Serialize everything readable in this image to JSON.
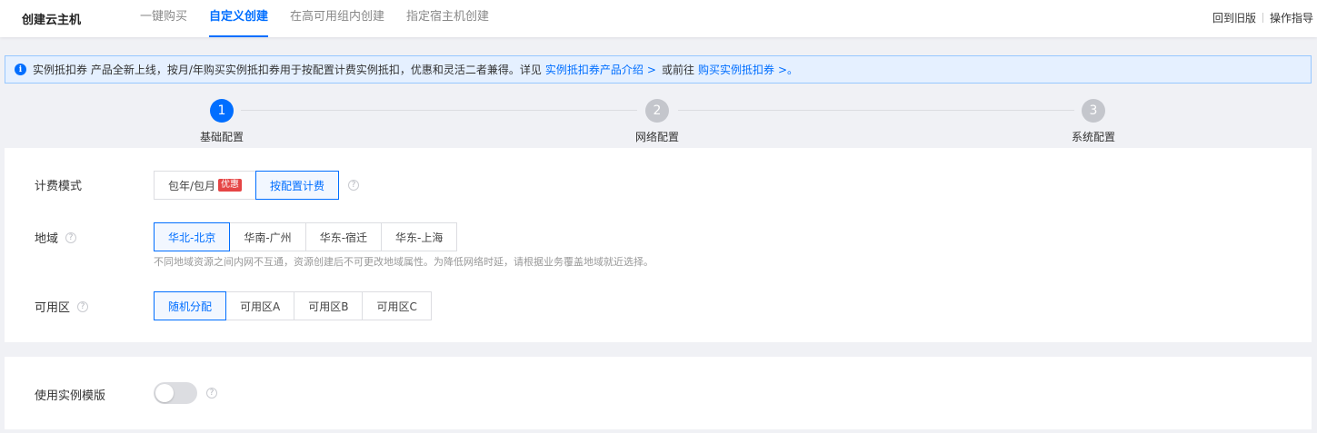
{
  "header": {
    "title": "创建云主机",
    "tabs": [
      {
        "label": "一键购买",
        "active": false
      },
      {
        "label": "自定义创建",
        "active": true
      },
      {
        "label": "在高可用组内创建",
        "active": false
      },
      {
        "label": "指定宿主机创建",
        "active": false
      }
    ],
    "links": {
      "back_old": "回到旧版",
      "guide": "操作指导"
    }
  },
  "notice": {
    "icon": "info-icon",
    "text1": "实例抵扣券 产品全新上线，按月/年购买实例抵扣券用于按配置计费实例抵扣，优惠和灵活二者兼得。详见",
    "link1": "实例抵扣券产品介绍",
    "arrow1": ">",
    "text2": "或前往",
    "link2": "购买实例抵扣券",
    "arrow2": ">。"
  },
  "steps": [
    {
      "number": "1",
      "label": "基础配置",
      "active": true
    },
    {
      "number": "2",
      "label": "网络配置",
      "active": false
    },
    {
      "number": "3",
      "label": "系统配置",
      "active": false
    }
  ],
  "billing": {
    "label": "计费模式",
    "options": [
      {
        "label": "包年/包月",
        "badge": "优惠",
        "selected": false
      },
      {
        "label": "按配置计费",
        "selected": true
      }
    ]
  },
  "region": {
    "label": "地域",
    "options": [
      {
        "label": "华北-北京",
        "selected": true
      },
      {
        "label": "华南-广州",
        "selected": false
      },
      {
        "label": "华东-宿迁",
        "selected": false
      },
      {
        "label": "华东-上海",
        "selected": false
      }
    ],
    "hint": "不同地域资源之间内网不互通，资源创建后不可更改地域属性。为降低网络时延，请根据业务覆盖地域就近选择。"
  },
  "zone": {
    "label": "可用区",
    "options": [
      {
        "label": "随机分配",
        "selected": true
      },
      {
        "label": "可用区A",
        "selected": false
      },
      {
        "label": "可用区B",
        "selected": false
      },
      {
        "label": "可用区C",
        "selected": false
      }
    ]
  },
  "template": {
    "label": "使用实例模版",
    "enabled": false
  },
  "colors": {
    "accent": "#006eff",
    "badge": "#e54545"
  }
}
